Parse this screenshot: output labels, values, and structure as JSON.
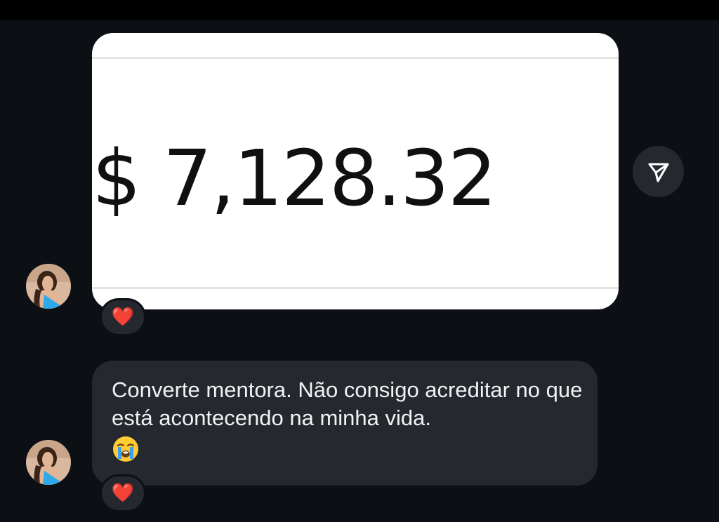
{
  "messages": [
    {
      "type": "image",
      "image_text": "$ 7,128.32",
      "reaction": "❤️"
    },
    {
      "type": "text",
      "text": "Converte mentora. Não consigo acreditar no que está acontecendo na minha vida.",
      "emoji": "😭",
      "reaction": "❤️"
    }
  ],
  "icons": {
    "share": "send-icon",
    "emoji": "loudly-crying-face-icon",
    "reaction": "heart-icon"
  },
  "colors": {
    "background": "#0c0f14",
    "bubble": "#25292f",
    "heart": "#f01e33",
    "emoji_face": "#ffcc33",
    "tears": "#3aa0f0"
  }
}
